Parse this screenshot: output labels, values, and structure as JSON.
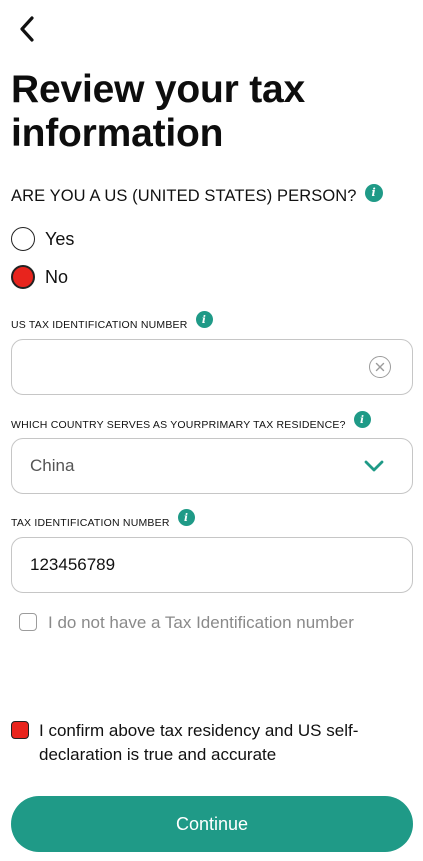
{
  "header": {
    "title": "Review your tax information"
  },
  "us_person": {
    "question": "ARE YOU A US (UNITED STATES) PERSON?",
    "options": [
      {
        "label": "Yes",
        "selected": false
      },
      {
        "label": "No",
        "selected": true
      }
    ]
  },
  "us_tin": {
    "label": "US TAX IDENTIFICATION NUMBER",
    "value": ""
  },
  "residence": {
    "label": "WHICH COUNTRY SERVES AS YOURPRIMARY TAX RESIDENCE?",
    "selected": "China"
  },
  "tin": {
    "label": "TAX IDENTIFICATION NUMBER",
    "value": "123456789"
  },
  "no_tin": {
    "label": "I do not have a Tax Identification number",
    "checked": false
  },
  "confirm": {
    "label": "I confirm above tax residency and US self-declaration is true and accurate",
    "checked": true
  },
  "footer": {
    "continue_label": "Continue"
  },
  "colors": {
    "accent": "#1f9a87",
    "selected_red": "#e8241d"
  }
}
